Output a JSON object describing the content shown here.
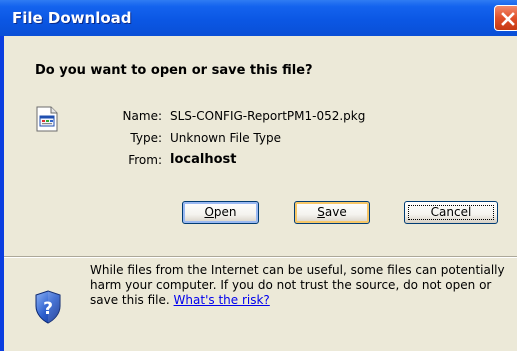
{
  "window": {
    "title": "File Download"
  },
  "dialog": {
    "question": "Do you want to open or save this file?",
    "name_label": "Name:",
    "name_value": "SLS-CONFIG-ReportPM1-052.pkg",
    "type_label": "Type:",
    "type_value": "Unknown File Type",
    "from_label": "From:",
    "from_value": "localhost",
    "file_icon": "generic-file-icon"
  },
  "buttons": {
    "open_prefix": "",
    "open_accel": "O",
    "open_rest": "pen",
    "save_prefix": "",
    "save_accel": "S",
    "save_rest": "ave",
    "cancel": "Cancel"
  },
  "warning": {
    "icon": "shield-question-icon",
    "text": "While files from the Internet can be useful, some files can potentially harm your computer. If you do not trust the source, do not open or save this file.",
    "link": "What's the risk?"
  },
  "colors": {
    "titlebar": "#0b57e4",
    "client_bg": "#ece9d8",
    "close_button": "#e0502a",
    "link": "#0000ee"
  }
}
